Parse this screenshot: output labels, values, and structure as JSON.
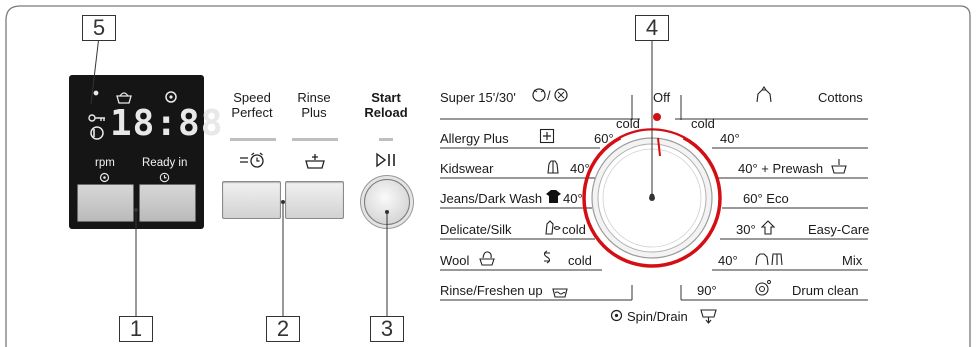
{
  "callouts": {
    "c1": "1",
    "c2": "2",
    "c3": "3",
    "c4": "4",
    "c5": "5"
  },
  "display": {
    "time": "18:88",
    "rpm_label": "rpm",
    "ready_label": "Ready in"
  },
  "buttons": {
    "speed_perfect": "Speed\nPerfect",
    "rinse_plus": "Rinse\nPlus",
    "start_reload": "Start\nReload"
  },
  "programs_left": [
    {
      "name": "Super 15'/30'",
      "temp": ""
    },
    {
      "name": "Allergy Plus",
      "temp": "60°"
    },
    {
      "name": "Kidswear",
      "temp": "40°"
    },
    {
      "name": "Jeans/Dark Wash",
      "temp": "40°"
    },
    {
      "name": "Delicate/Silk",
      "temp": "cold"
    },
    {
      "name": "Wool",
      "temp": "cold"
    },
    {
      "name": "Rinse/Freshen up",
      "temp": ""
    }
  ],
  "programs_right": [
    {
      "name": "Cottons",
      "temp": ""
    },
    {
      "name": "",
      "temp": "40°"
    },
    {
      "name": "40° + Prewash",
      "temp": ""
    },
    {
      "name": "60° Eco",
      "temp": ""
    },
    {
      "name": "Easy-Care",
      "temp": "30°"
    },
    {
      "name": "Mix",
      "temp": "40°"
    },
    {
      "name": "Drum clean",
      "temp": "90°"
    }
  ],
  "dial": {
    "off_label": "Off",
    "cold_left": "cold",
    "cold_right": "cold",
    "bottom_label": "Spin/Drain"
  },
  "colors": {
    "ring": "#d40f14",
    "display_bg": "#151515"
  },
  "icons": {
    "display": [
      "laundry-basket-icon",
      "key-lock-icon",
      "spin-icon",
      "drum-icon"
    ],
    "buttons": [
      "speed-clock-icon",
      "rinse-plus-icon",
      "play-pause-icon"
    ]
  }
}
